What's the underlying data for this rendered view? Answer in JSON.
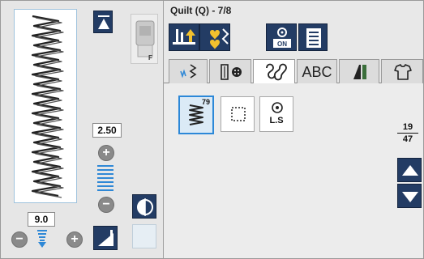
{
  "window": {
    "title": "Quilt (Q) - 7/8"
  },
  "left_panel": {
    "presser_foot": {
      "label": "F"
    },
    "stitch_width": {
      "value": "2.50",
      "plus_label": "+",
      "minus_label": "−"
    },
    "stitch_length": {
      "value": "9.0",
      "plus_label": "+",
      "minus_label": "−"
    }
  },
  "pattern_tabs": {
    "letters_label": "ABC",
    "active_tab": "decorative"
  },
  "patterns": {
    "selected_stitch_count": "79",
    "locking_stitch_label": "L.S"
  },
  "pagination": {
    "current": "19",
    "total": "47"
  },
  "colors": {
    "button_dark": "#233c64",
    "accent_blue": "#2c88d8",
    "heart_yellow": "#f2c12e"
  }
}
